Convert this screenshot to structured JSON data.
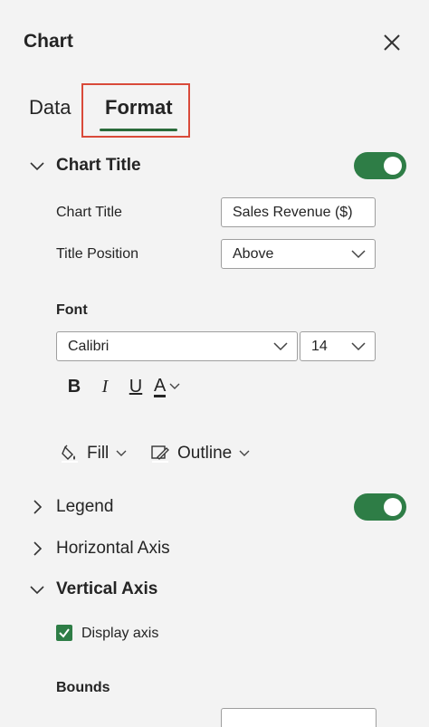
{
  "pane": {
    "title": "Chart",
    "close_icon": "close-icon"
  },
  "tabs": [
    {
      "label": "Data",
      "active": false
    },
    {
      "label": "Format",
      "active": true
    }
  ],
  "colors": {
    "accent": "#2e7d46",
    "tab_highlight_border": "#d94a3a",
    "panel_bg": "#f3f3f3"
  },
  "chart_title_section": {
    "label": "Chart Title",
    "expanded": true,
    "toggle_on": true,
    "title_label": "Chart Title",
    "title_value": "Sales Revenue ($)",
    "position_label": "Title Position",
    "position_value": "Above"
  },
  "font": {
    "label": "Font",
    "family_value": "Calibri",
    "size_value": "14",
    "bold_label": "B",
    "italic_label": "I",
    "underline_label": "U",
    "color_label": "A"
  },
  "fill": {
    "label": "Fill"
  },
  "outline": {
    "label": "Outline"
  },
  "legend_section": {
    "label": "Legend",
    "expanded": false,
    "toggle_on": true
  },
  "horizontal_axis_section": {
    "label": "Horizontal Axis",
    "expanded": false
  },
  "vertical_axis_section": {
    "label": "Vertical Axis",
    "expanded": true,
    "display_axis_label": "Display axis",
    "display_axis_checked": true,
    "bounds_label": "Bounds"
  }
}
